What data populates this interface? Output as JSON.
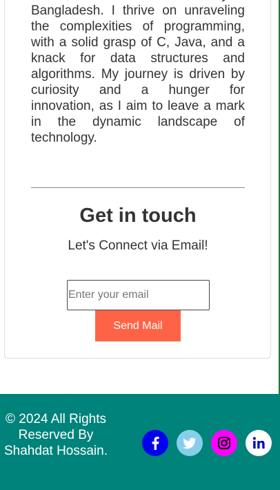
{
  "about": {
    "text": "CSE student at Green University of Bangladesh. I thrive on unraveling the complexities of programming, with a solid grasp of C, Java, and a knack for data structures and algorithms. My journey is driven by curiosity and a hunger for innovation, as I aim to leave a mark in the dynamic landscape of technology."
  },
  "contact": {
    "title": "Get in touch",
    "subtitle": "Let's Connect via Email!",
    "email_placeholder": "Enter your email",
    "email_value": "",
    "send_label": "Send Mail"
  },
  "footer": {
    "copyright": "© 2024 All Rights Reserved By Shahdat Hossain.",
    "social": [
      {
        "name": "facebook",
        "icon": "facebook-icon",
        "color": "#0000ee"
      },
      {
        "name": "twitter",
        "icon": "twitter-icon",
        "color": "#87ceeb"
      },
      {
        "name": "instagram",
        "icon": "instagram-icon",
        "color": "#ff00ff"
      },
      {
        "name": "linkedin",
        "icon": "linkedin-icon",
        "color": "#ffffff"
      }
    ]
  },
  "colors": {
    "footer_background": "#00837a",
    "send_button": "#ff6347",
    "text": "#333333"
  }
}
